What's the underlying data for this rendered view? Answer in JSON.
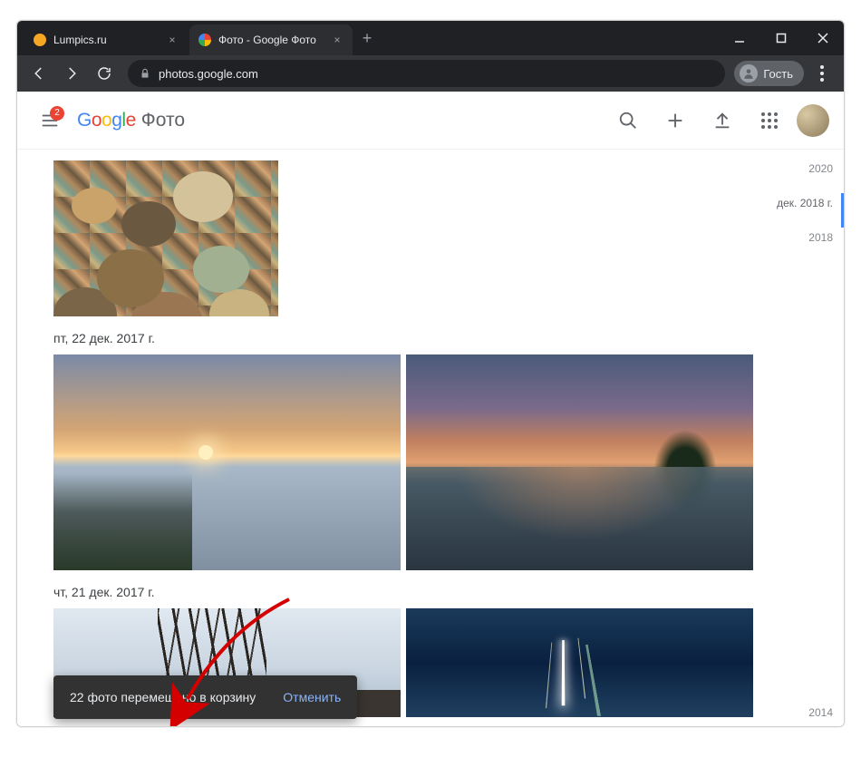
{
  "browser": {
    "tabs": [
      {
        "title": "Lumpics.ru",
        "active": false
      },
      {
        "title": "Фото - Google Фото",
        "active": true
      }
    ],
    "url": "photos.google.com",
    "guest_label": "Гость"
  },
  "header": {
    "badge_count": "2",
    "logo_letters": [
      "G",
      "o",
      "o",
      "g",
      "l",
      "e"
    ],
    "product_name": "Фото"
  },
  "timeline": {
    "y1": "2020",
    "current": "дек. 2018 г.",
    "y2": "2018",
    "bottom": "2014"
  },
  "groups": {
    "date1": "пт, 22 дек. 2017 г.",
    "date2": "чт, 21 дек. 2017 г."
  },
  "toast": {
    "message": "22 фото перемещено в корзину",
    "undo": "Отменить"
  }
}
